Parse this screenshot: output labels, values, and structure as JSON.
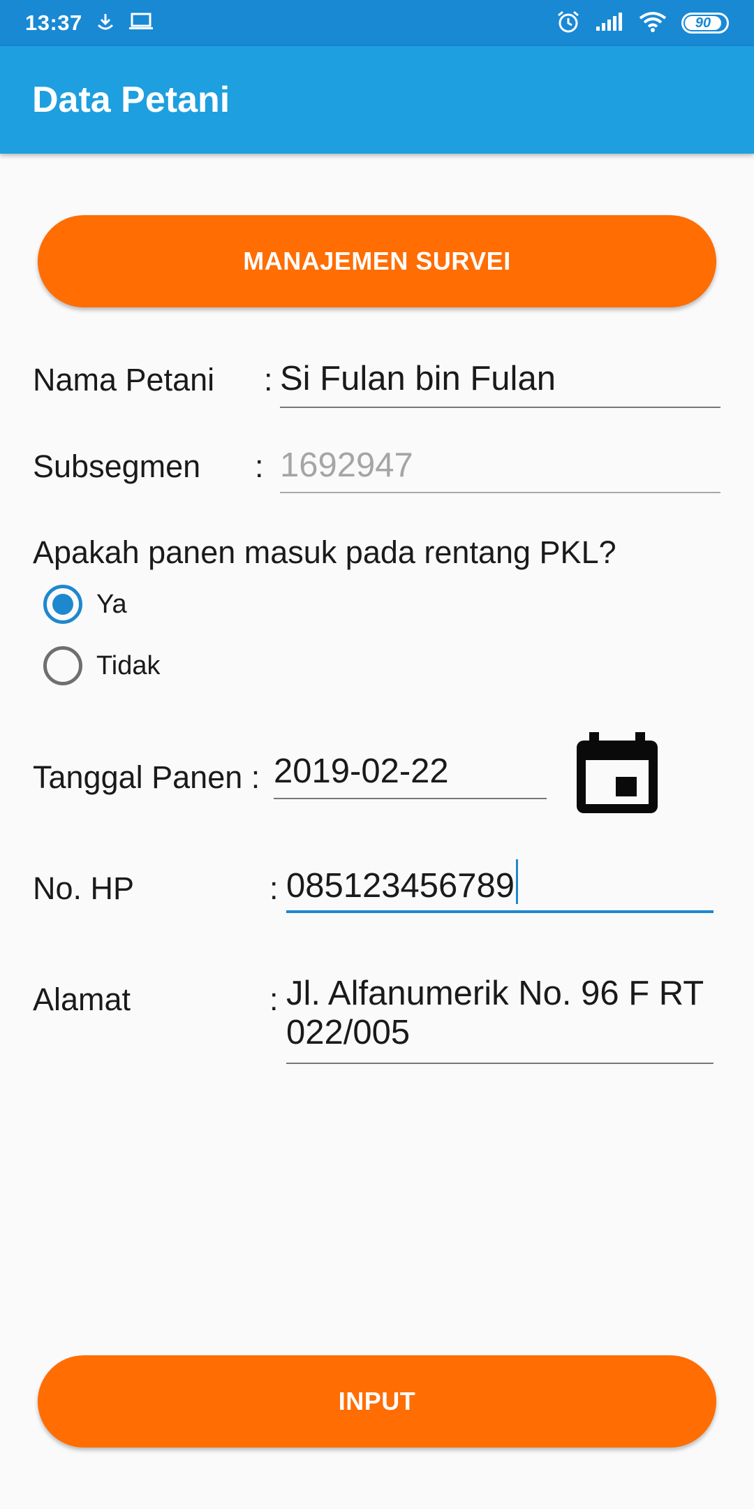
{
  "status_bar": {
    "time": "13:37",
    "battery": "90",
    "icons": [
      "download-icon",
      "laptop-icon",
      "alarm-icon",
      "signal-icon",
      "wifi-icon",
      "battery-icon"
    ]
  },
  "app_bar": {
    "title": "Data Petani"
  },
  "buttons": {
    "manage_survey": "MANAJEMEN SURVEI",
    "input": "INPUT"
  },
  "form": {
    "nama_petani": {
      "label": "Nama Petani",
      "colon": ":",
      "value": "Si Fulan bin Fulan"
    },
    "subsegmen": {
      "label": "Subsegmen",
      "colon": ":",
      "placeholder": "1692947"
    },
    "harvest_question": {
      "label": "Apakah panen masuk pada rentang PKL?",
      "options": [
        {
          "label": "Ya",
          "selected": true
        },
        {
          "label": "Tidak",
          "selected": false
        }
      ]
    },
    "tanggal_panen": {
      "label": "Tanggal Panen :",
      "value": "2019-02-22"
    },
    "no_hp": {
      "label": "No. HP",
      "colon": ":",
      "value": "085123456789"
    },
    "alamat": {
      "label": "Alamat",
      "colon": ":",
      "value_line1": "Jl. Alfanumerik No. 96 F RT",
      "value_line2": "022/005"
    }
  },
  "colors": {
    "status_bar": "#1989d4",
    "app_bar": "#1e9fdf",
    "accent_orange": "#ff6d03",
    "radio_blue": "#1e88cf"
  }
}
